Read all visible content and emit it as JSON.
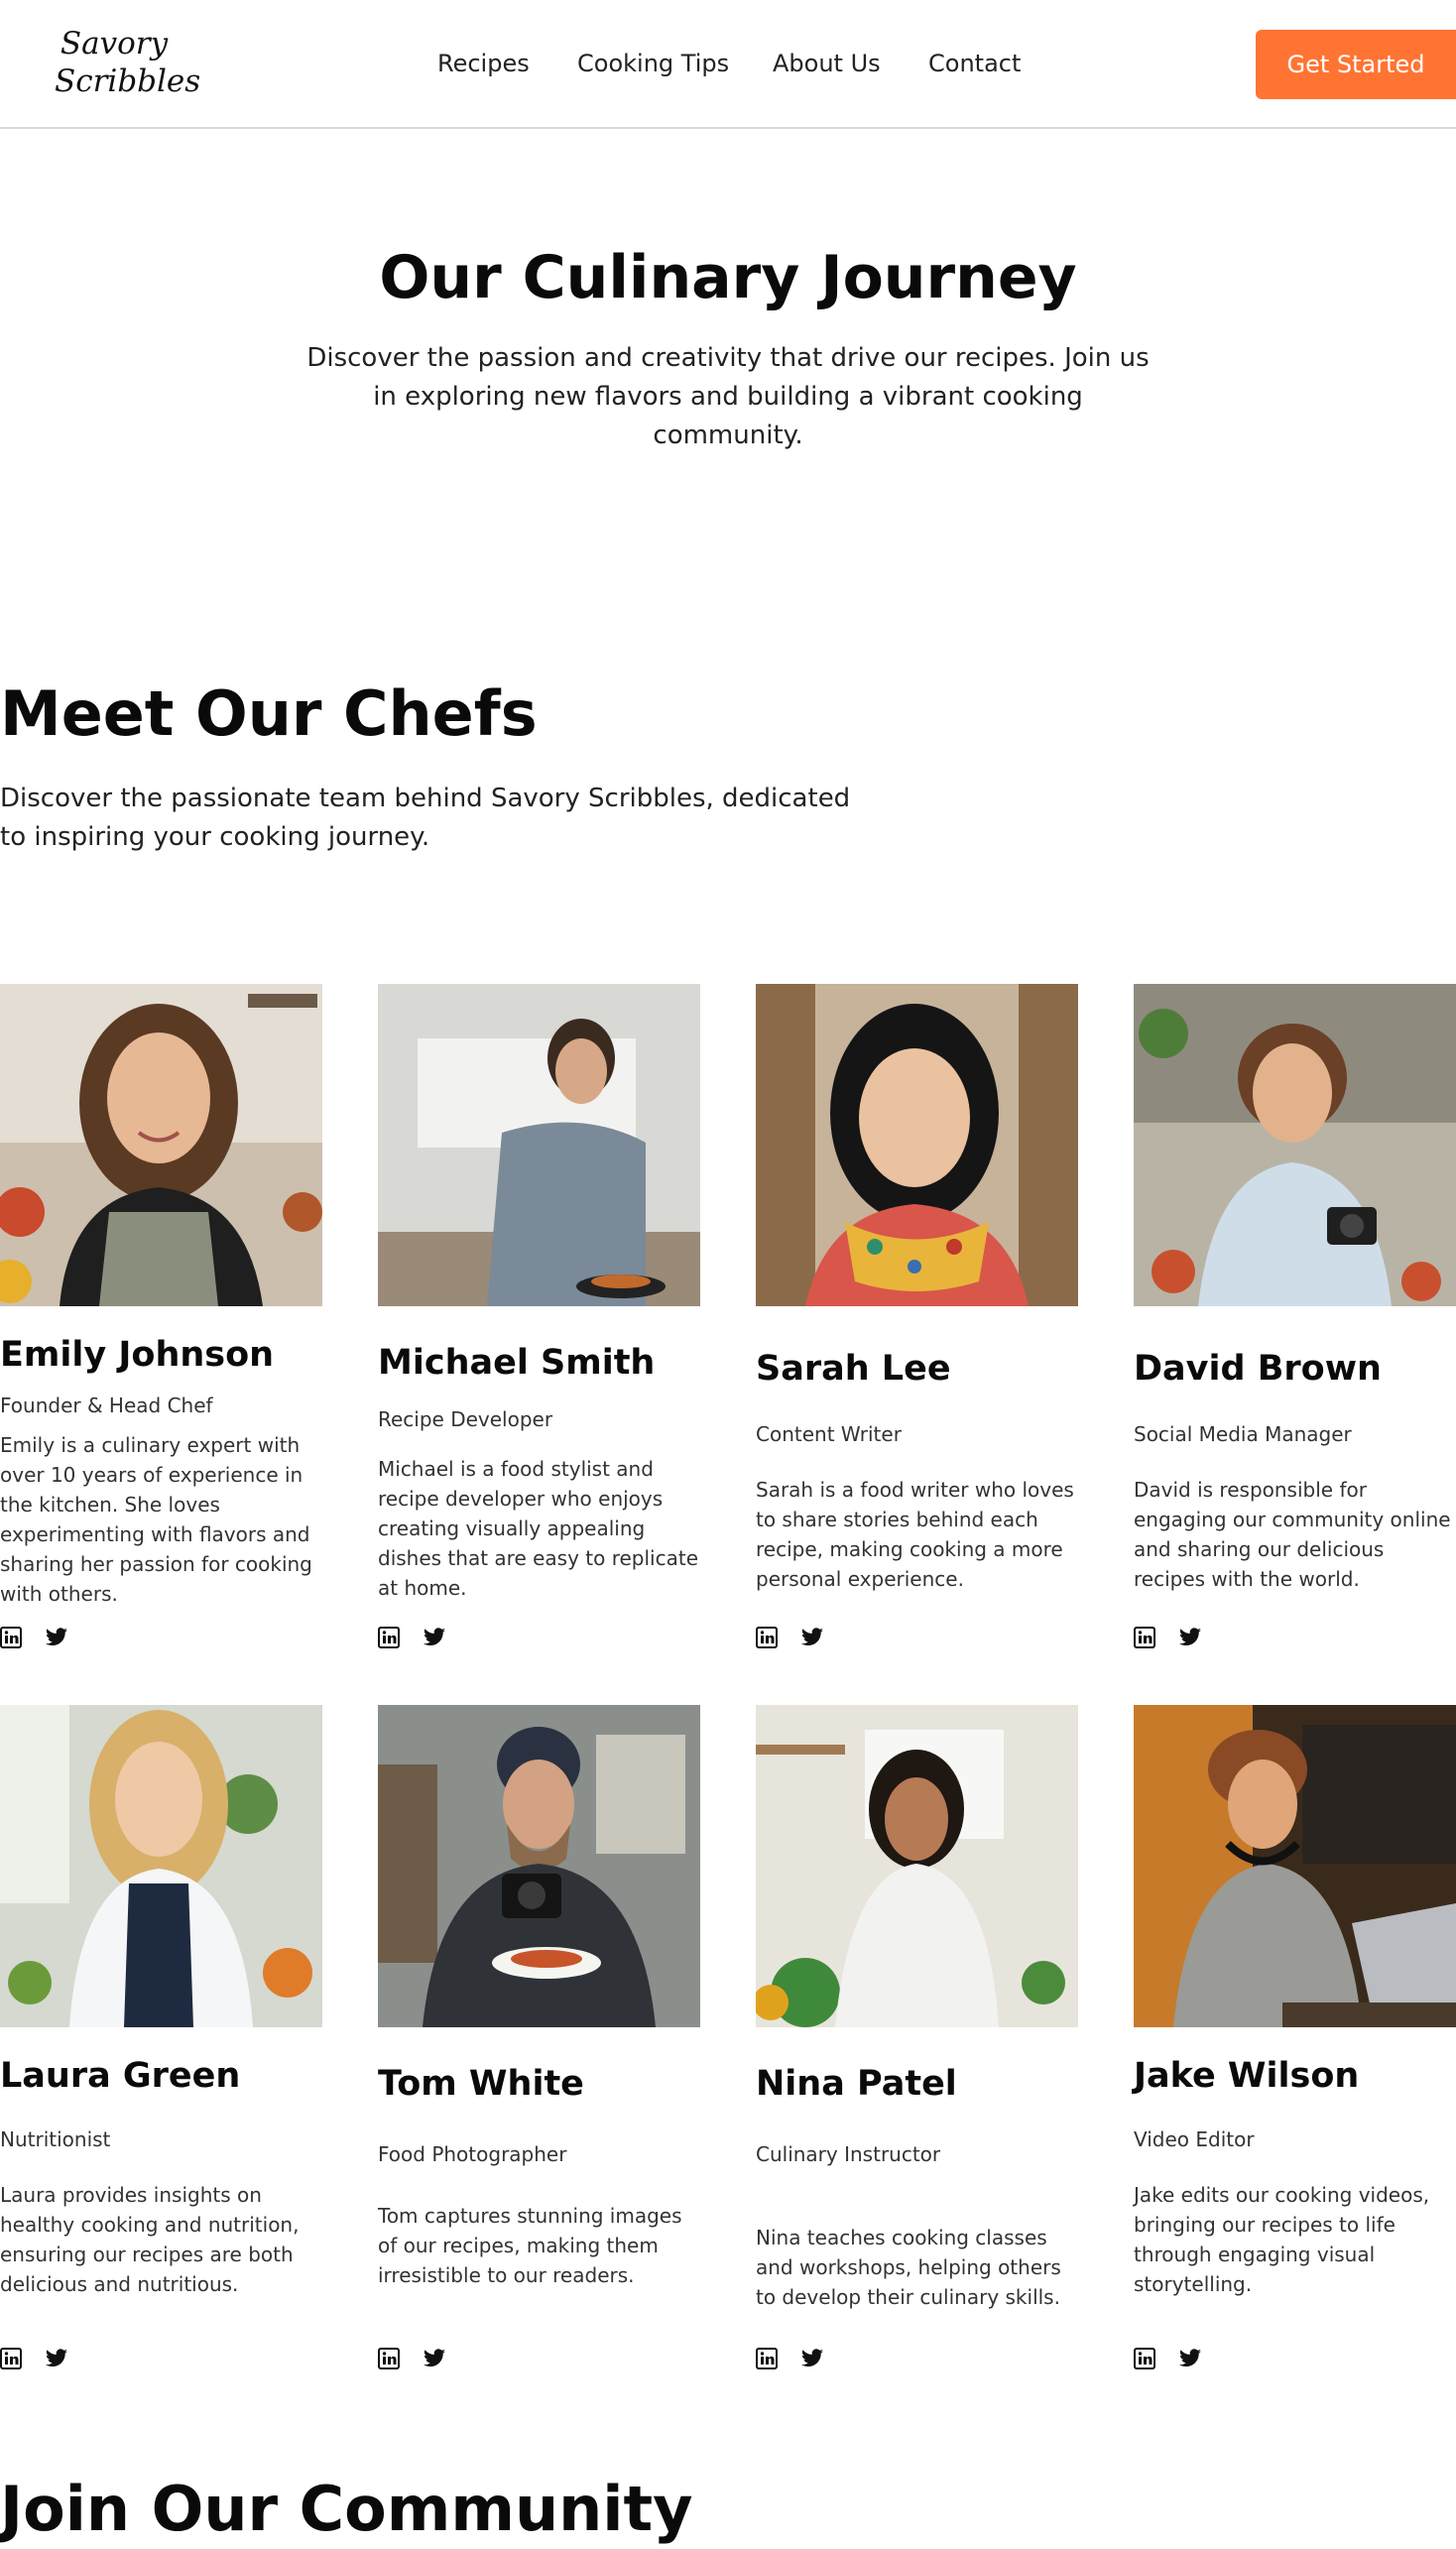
{
  "brand": {
    "logo_line1": "Savory",
    "logo_line2": "Scribbles"
  },
  "nav": {
    "links": [
      "Recipes",
      "Cooking Tips",
      "About Us",
      "Contact"
    ],
    "cta_label": "Get Started",
    "cta_color": "#ff7433"
  },
  "hero": {
    "title": "Our Culinary Journey",
    "subtitle": "Discover the passion and creativity that drive our recipes. Join us in exploring new flavors and building a vibrant cooking community."
  },
  "chefs_section": {
    "title": "Meet Our Chefs",
    "subtitle": "Discover the passionate team behind Savory Scribbles, dedicated to inspiring your cooking journey.",
    "members": [
      {
        "name": "Emily Johnson",
        "role": "Founder & Head Chef",
        "bio": "Emily is a culinary expert with over 10 years of experience in the kitchen. She loves experimenting with flavors and sharing her passion for cooking with others.",
        "photo": "portrait-chef-woman-kitchen"
      },
      {
        "name": "Michael Smith",
        "role": "Recipe Developer",
        "bio": "Michael is a food stylist and recipe developer who enjoys creating visually appealing dishes that are easy to replicate at home.",
        "photo": "man-cooking-at-stove"
      },
      {
        "name": "Sarah Lee",
        "role": "Content Writer",
        "bio": "Sarah is a food writer who loves to share stories behind each recipe, making cooking a more personal experience.",
        "photo": "portrait-woman-scarf-kitchen"
      },
      {
        "name": "David Brown",
        "role": "Social Media Manager",
        "bio": "David is responsible for engaging our community online and sharing our delicious recipes with the world.",
        "photo": "man-with-camera-kitchen"
      },
      {
        "name": "Laura Green",
        "role": "Nutritionist",
        "bio": "Laura provides insights on healthy cooking and nutrition, ensuring our recipes are both delicious and nutritious.",
        "photo": "woman-blonde-kitchen-vegetables"
      },
      {
        "name": "Tom White",
        "role": "Food Photographer",
        "bio": "Tom captures stunning images of our recipes, making them irresistible to our readers.",
        "photo": "photographer-holding-plate"
      },
      {
        "name": "Nina Patel",
        "role": "Culinary Instructor",
        "bio": "Nina teaches cooking classes and workshops, helping others to develop their culinary skills.",
        "photo": "chef-woman-white-coat"
      },
      {
        "name": "Jake Wilson",
        "role": "Video Editor",
        "bio": "Jake edits our cooking videos, bringing our recipes to life through engaging visual storytelling.",
        "photo": "young-man-laptop-headphones"
      }
    ],
    "social_icons": [
      "linkedin-icon",
      "twitter-icon"
    ]
  },
  "join_section": {
    "title": "Join Our Community"
  }
}
